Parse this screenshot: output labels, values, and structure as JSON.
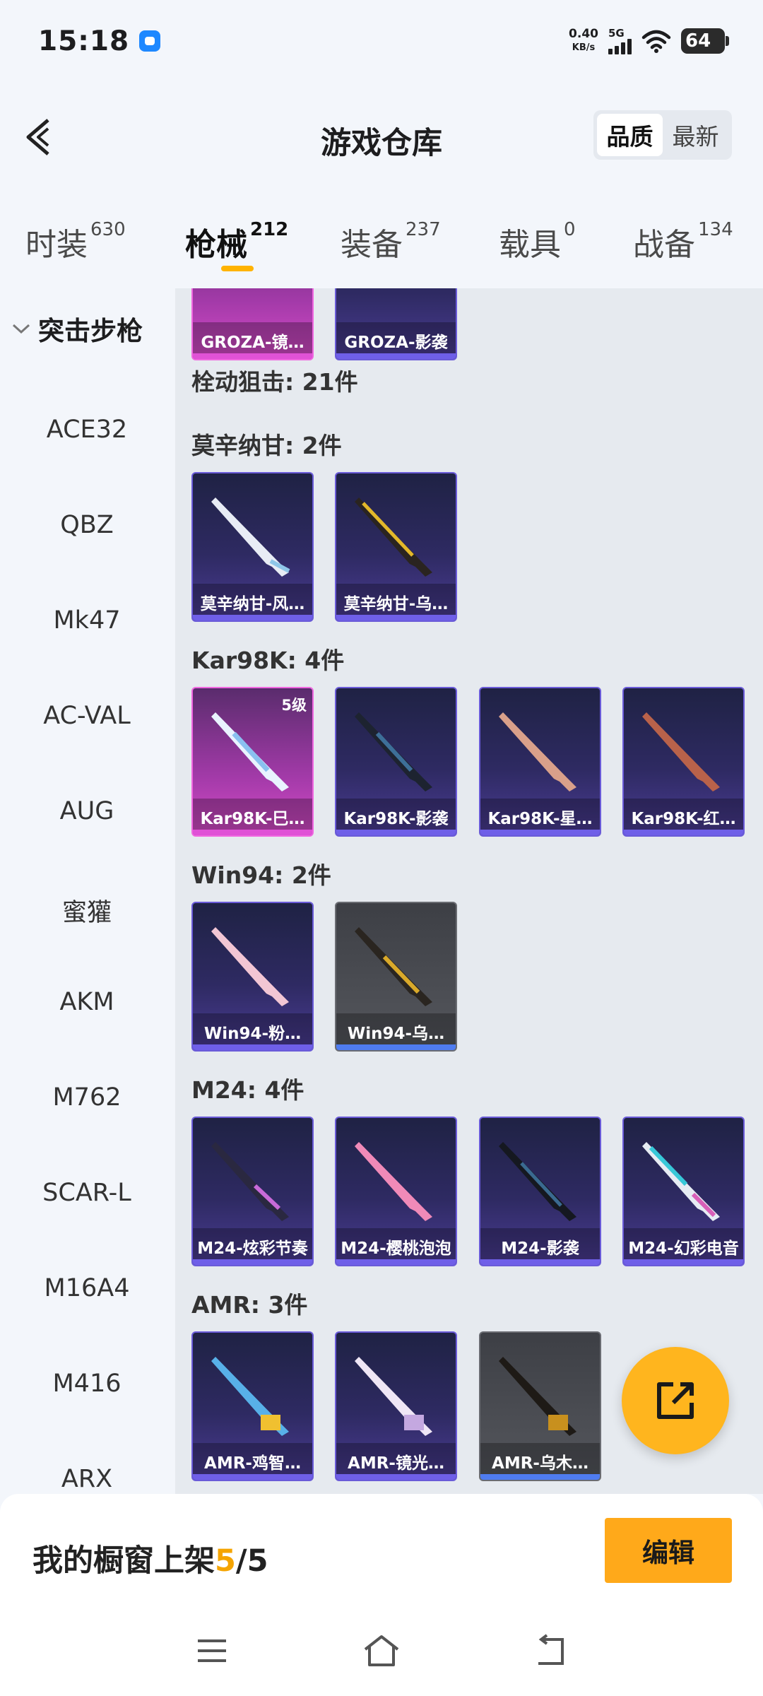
{
  "status_bar": {
    "time": "15:18",
    "net_speed": "0.40",
    "net_unit": "KB/s",
    "network": "5G",
    "battery": "64"
  },
  "header": {
    "title": "游戏仓库",
    "sort_options": [
      "品质",
      "最新"
    ],
    "active_sort": "品质"
  },
  "tabs": [
    {
      "label": "时装",
      "count": "630"
    },
    {
      "label": "枪械",
      "count": "212"
    },
    {
      "label": "装备",
      "count": "237"
    },
    {
      "label": "载具",
      "count": "0"
    },
    {
      "label": "战备",
      "count": "134"
    }
  ],
  "sidebar": {
    "group": "突击步枪",
    "items": [
      "ACE32",
      "QBZ",
      "Mk47",
      "AC-VAL",
      "AUG",
      "蜜獾",
      "AKM",
      "M762",
      "SCAR-L",
      "M16A4",
      "M416",
      "ARX"
    ]
  },
  "content": {
    "partial_row": [
      "GROZA-镜…",
      "GROZA-影袭"
    ],
    "category_title": "栓动狙击: 21件",
    "sections": [
      {
        "title": "莫辛纳甘: 2件",
        "items": [
          {
            "name": "莫辛纳甘-风…"
          },
          {
            "name": "莫辛纳甘-乌…"
          }
        ]
      },
      {
        "title": "Kar98K: 4件",
        "items": [
          {
            "name": "Kar98K-巳…",
            "level": "5级"
          },
          {
            "name": "Kar98K-影袭"
          },
          {
            "name": "Kar98K-星…"
          },
          {
            "name": "Kar98K-红…"
          }
        ]
      },
      {
        "title": "Win94: 2件",
        "items": [
          {
            "name": "Win94-粉…"
          },
          {
            "name": "Win94-乌…"
          }
        ]
      },
      {
        "title": "M24: 4件",
        "items": [
          {
            "name": "M24-炫彩节奏"
          },
          {
            "name": "M24-樱桃泡泡"
          },
          {
            "name": "M24-影袭"
          },
          {
            "name": "M24-幻彩电音"
          }
        ]
      },
      {
        "title": "AMR: 3件",
        "items": [
          {
            "name": "AMR-鸡智…"
          },
          {
            "name": "AMR-镜光…"
          },
          {
            "name": "AMR-乌木…"
          }
        ]
      }
    ]
  },
  "showcase": {
    "label": "我的橱窗上架",
    "current": "5",
    "separator": "/",
    "total": "5",
    "edit_label": "编辑"
  },
  "icons": {
    "back": "back-arrow-icon",
    "share": "share-external-icon",
    "menu": "menu-icon",
    "home": "home-icon",
    "return": "return-icon",
    "accent_color": "#ffb300"
  }
}
